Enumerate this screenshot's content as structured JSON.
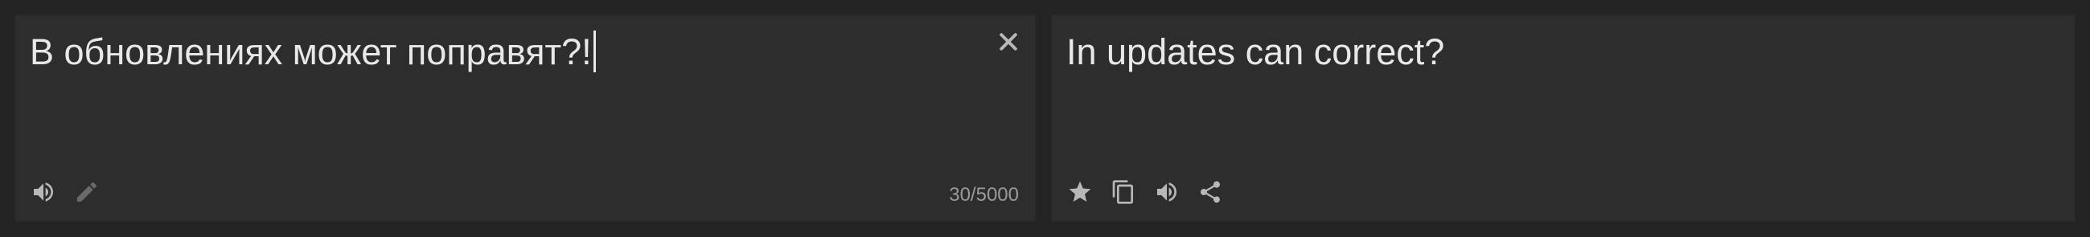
{
  "source": {
    "text": "В обновлениях может поправят?!",
    "char_count": "30/5000",
    "icons": [
      "speaker-icon",
      "pencil-icon",
      "close-icon"
    ]
  },
  "target": {
    "text": "In updates can correct?",
    "icons": [
      "star-icon",
      "copy-icon",
      "speaker-icon",
      "share-icon"
    ]
  },
  "colors": {
    "background": "#232323",
    "panel": "#2d2d2d",
    "text": "#e8e8e8",
    "icon": "#b8b8b8",
    "icon_dim": "#6a6a6a",
    "counter": "#9a9a9a"
  }
}
